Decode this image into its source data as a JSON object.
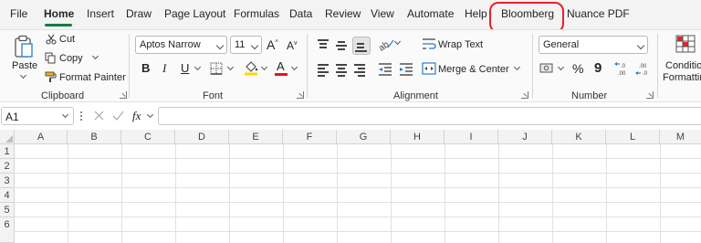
{
  "tabs": [
    "File",
    "Home",
    "Insert",
    "Draw",
    "Page Layout",
    "Formulas",
    "Data",
    "Review",
    "View",
    "Automate",
    "Help",
    "Bloomberg",
    "Nuance PDF"
  ],
  "active_tab": "Home",
  "highlighted_tab": "Bloomberg",
  "clipboard": {
    "paste_label": "Paste",
    "cut_label": "Cut",
    "copy_label": "Copy",
    "format_painter_label": "Format Painter",
    "group_label": "Clipboard"
  },
  "font": {
    "font_name": "Aptos Narrow",
    "font_size": "11",
    "bold": "B",
    "italic": "I",
    "underline": "U",
    "group_label": "Font"
  },
  "alignment": {
    "wrap_text_label": "Wrap Text",
    "merge_center_label": "Merge & Center",
    "group_label": "Alignment"
  },
  "number": {
    "format_value": "General",
    "percent": "%",
    "comma": "9",
    "group_label": "Number"
  },
  "styles": {
    "conditional_formatting_line1": "Conditio",
    "conditional_formatting_line2": "Formattin"
  },
  "formula_bar": {
    "name_box": "A1",
    "fx": "fx",
    "value": ""
  },
  "columns": [
    "A",
    "B",
    "C",
    "D",
    "E",
    "F",
    "G",
    "H",
    "I",
    "J",
    "K",
    "L",
    "M"
  ],
  "rows": [
    "1",
    "2",
    "3",
    "4",
    "5",
    "6"
  ],
  "colors": {
    "accent_green": "#107c41",
    "highlight_red": "#e8202a",
    "fill_yellow": "#ffd800",
    "font_red": "#e81123"
  }
}
